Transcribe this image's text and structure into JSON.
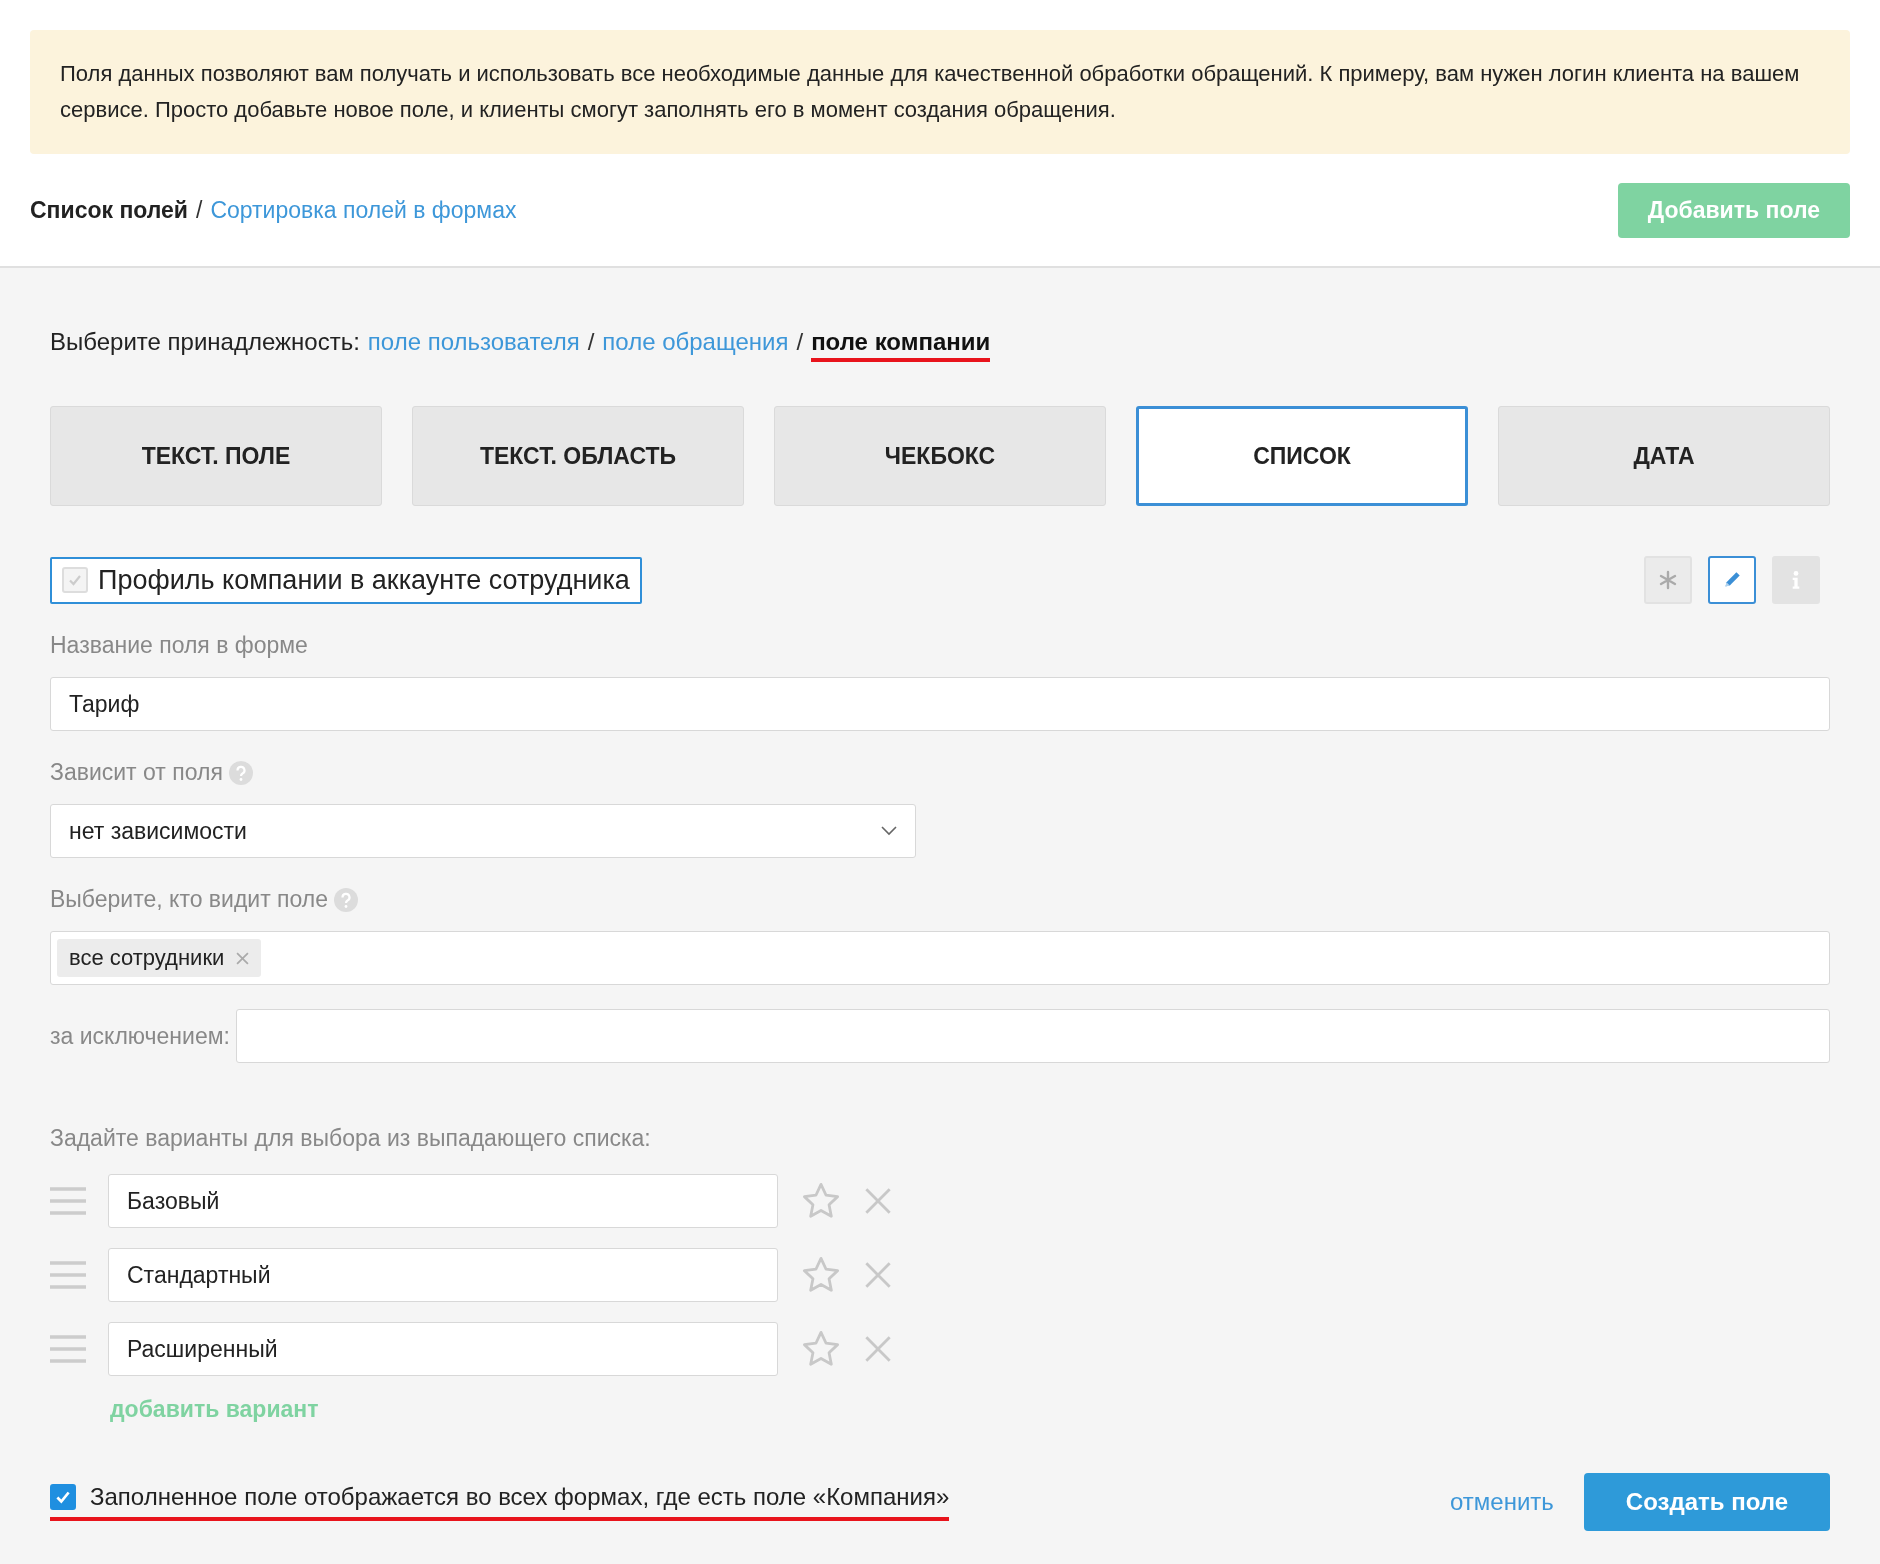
{
  "notice": {
    "text": "Поля данных позволяют вам получать и использовать все необходимые данные для качественной обработки обращений. К примеру, вам нужен логин клиента на вашем сервисе. Просто добавьте новое поле, и клиенты смогут заполнять его в момент создания обращения."
  },
  "header": {
    "title": "Список полей",
    "separator": "/",
    "link": "Сортировка полей в формах",
    "add_button": "Добавить поле"
  },
  "belonging": {
    "label": "Выберите принадлежность:",
    "separator": "/",
    "options": [
      {
        "label": "поле пользователя",
        "selected": false,
        "underlined": false
      },
      {
        "label": "поле обращения",
        "selected": false,
        "underlined": false
      },
      {
        "label": "поле компании",
        "selected": true,
        "underlined": true
      }
    ]
  },
  "field_types": [
    {
      "label": "ТЕКСТ. ПОЛЕ",
      "selected": false
    },
    {
      "label": "ТЕКСТ. ОБЛАСТЬ",
      "selected": false
    },
    {
      "label": "ЧЕКБОКС",
      "selected": false
    },
    {
      "label": "СПИСОК",
      "selected": true
    },
    {
      "label": "ДАТА",
      "selected": false
    }
  ],
  "profile_toggle": {
    "label": "Профиль компании в аккаунте сотрудника",
    "checked": true,
    "disabled": true
  },
  "tools": [
    {
      "kind": "required",
      "selected": false,
      "disabled": false
    },
    {
      "kind": "edit",
      "selected": true,
      "disabled": false
    },
    {
      "kind": "info",
      "selected": false,
      "disabled": true
    }
  ],
  "name_field": {
    "label": "Название поля в форме",
    "value": "Тариф"
  },
  "depends": {
    "label": "Зависит от поля",
    "value": "нет зависимости"
  },
  "visibility": {
    "label": "Выберите, кто видит поле",
    "tags": [
      "все сотрудники"
    ]
  },
  "except": {
    "label": "за исключением:"
  },
  "options": {
    "label": "Задайте варианты для выбора из выпадающего списка:",
    "items": [
      "Базовый",
      "Стандартный",
      "Расширенный"
    ],
    "add_link": "добавить вариант"
  },
  "footer": {
    "checkbox": {
      "label": "Заполненное поле отображается во всех формах, где есть поле «Компания»",
      "checked": true,
      "underlined": true
    },
    "cancel": "отменить",
    "submit": "Создать поле"
  }
}
